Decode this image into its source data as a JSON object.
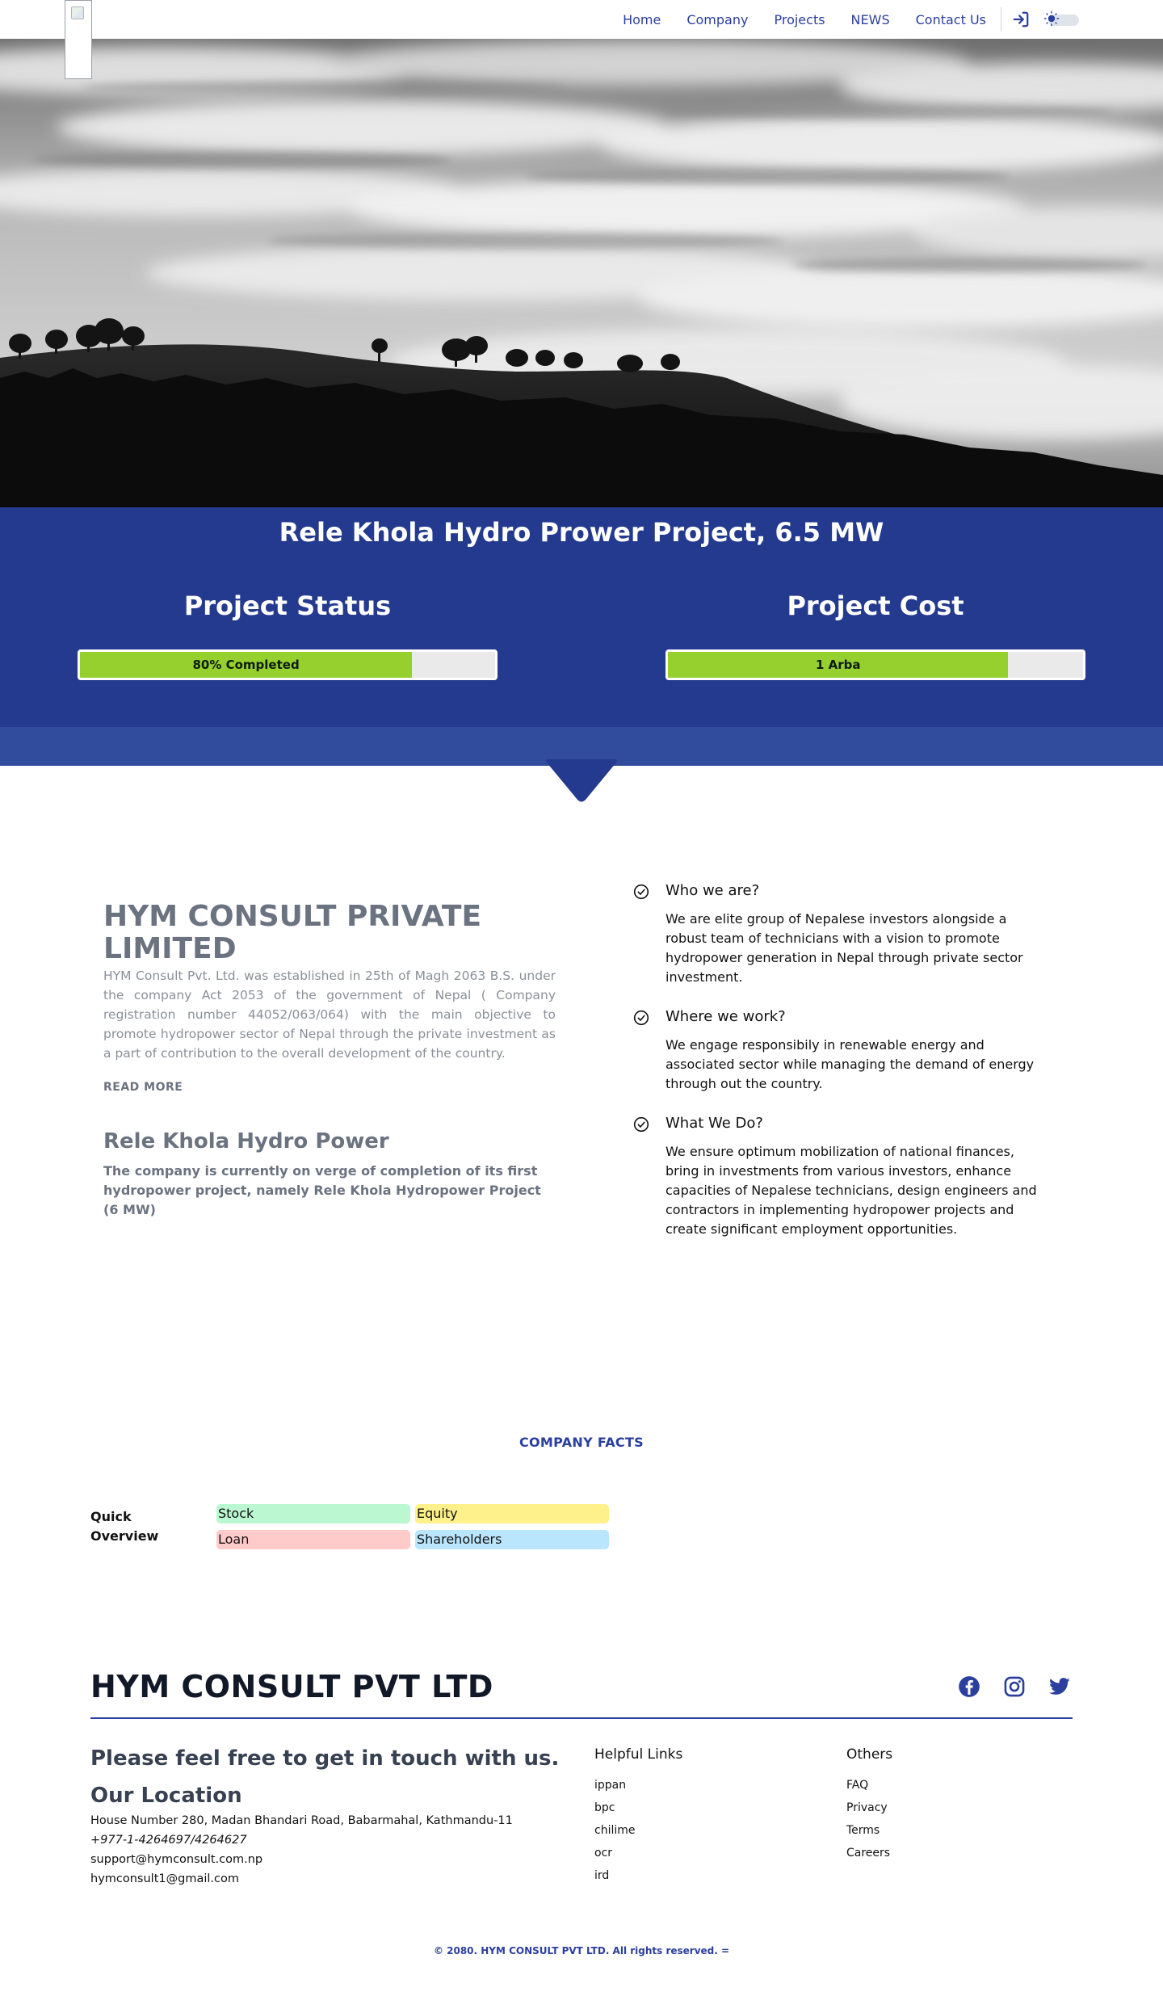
{
  "nav": {
    "links": [
      "Home",
      "Company",
      "Projects",
      "NEWS",
      "Contact Us"
    ]
  },
  "project": {
    "title": "Rele Khola Hydro Prower Project, 6.5 MW",
    "status": {
      "heading": "Project Status",
      "label": "80% Completed",
      "progress_percent": 80
    },
    "cost": {
      "heading": "Project Cost",
      "label": "1 Arba",
      "progress_percent": 82
    }
  },
  "about": {
    "company_name": "HYM CONSULT PRIVATE LIMITED",
    "description": "HYM Consult Pvt. Ltd. was established in 25th of Magh 2063 B.S. under the company Act 2053 of the government of Nepal ( Company registration number 44052/063/064) with the main objective to promote hydropower sector of Nepal through the private investment as a part of contribution to the overall development of the country.",
    "read_more": "READ MORE",
    "project_title": "Rele Khola Hydro Power",
    "project_desc": "The company is currently on verge of completion of its first hydropower project, namely Rele Khola Hydropower Project (6 MW)"
  },
  "features": [
    {
      "title": "Who we are?",
      "text": "We are elite group of Nepalese investors alongside a robust team of technicians with a vision to promote hydropower generation in Nepal through private sector investment."
    },
    {
      "title": "Where we work?",
      "text": "We engage responsibily in renewable energy and associated sector while managing the demand of energy through out the country."
    },
    {
      "title": "What We Do?",
      "text": "We ensure optimum mobilization of national finances, bring in investments from various investors, enhance capacities of Nepalese technicians, design engineers and contractors in implementing hydropower projects and create significant employment opportunities."
    }
  ],
  "facts": {
    "title": "COMPANY FACTS",
    "quick_overview": "Quick Overview",
    "items": [
      {
        "label": "Stock",
        "color": "#bbf7d0"
      },
      {
        "label": "Equity",
        "color": "#fef08a"
      },
      {
        "label": "Loan",
        "color": "#fecaca"
      },
      {
        "label": "Shareholders",
        "color": "#bae6fd"
      }
    ]
  },
  "footer": {
    "brand": "HYM CONSULT PVT LTD",
    "touch": "Please feel free to get in touch with us.",
    "location_title": "Our Location",
    "address": "House Number 280, Madan Bhandari Road, Babarmahal, Kathmandu-11",
    "phone": "+977-1-4264697/4264627",
    "email1": "support@hymconsult.com.np",
    "email2": "hymconsult1@gmail.com",
    "helpful_links_title": "Helpful Links",
    "helpful_links": [
      "ippan",
      "bpc",
      "chilime",
      "ocr",
      "ird"
    ],
    "others_title": "Others",
    "others": [
      "FAQ",
      "Privacy",
      "Terms",
      "Careers"
    ],
    "copyright": "© 2080. HYM CONSULT PVT LTD. All rights reserved. ="
  },
  "colors": {
    "brand_blue": "#2a3f9e",
    "band_blue": "#243a8e",
    "progress_green": "#95d02e"
  },
  "icons": [
    "login-icon",
    "theme-toggle-icon",
    "check-circle-icon",
    "facebook-icon",
    "instagram-icon",
    "twitter-icon"
  ]
}
